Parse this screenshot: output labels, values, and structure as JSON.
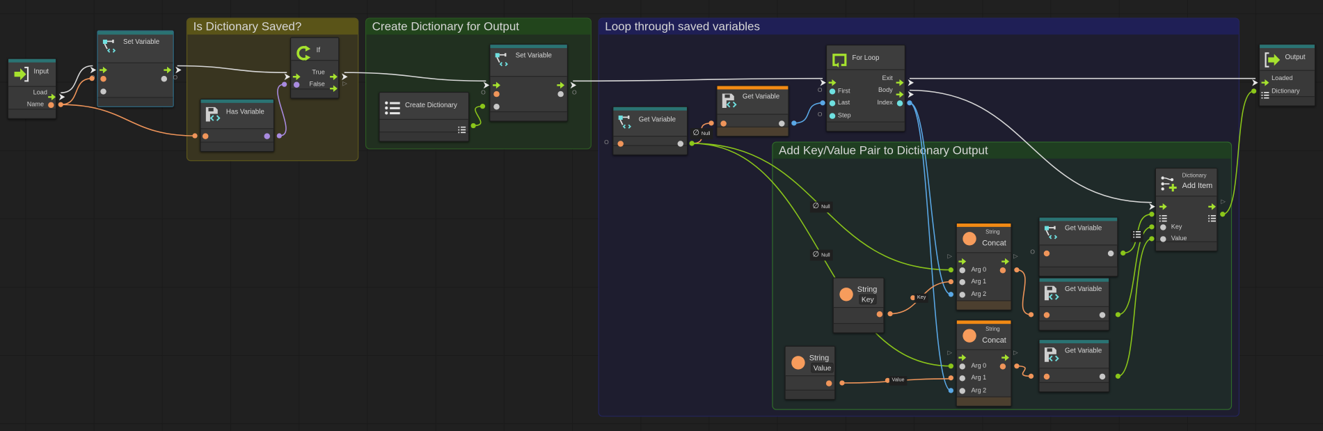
{
  "groups": {
    "is_dictionary_saved": {
      "title": "Is Dictionary Saved?"
    },
    "create_dictionary_for_output": {
      "title": "Create Dictionary for Output"
    },
    "loop_through_saved_variables": {
      "title": "Loop through saved variables"
    },
    "add_key_value_pair": {
      "title": "Add Key/Value Pair to Dictionary Output"
    }
  },
  "nodes": {
    "input": {
      "title": "Input",
      "ports": {
        "load": "Load",
        "name": "Name"
      },
      "icon": "input-enter-icon"
    },
    "set_variable_1": {
      "title": "Set Variable",
      "icon": "set-variable-icon"
    },
    "if": {
      "title": "If",
      "ports": {
        "true": "True",
        "false": "False"
      },
      "icon": "if-branch-icon"
    },
    "has_variable": {
      "title": "Has Variable",
      "icon": "saved-variable-icon"
    },
    "create_dictionary": {
      "title": "Create Dictionary",
      "icon": "list-icon"
    },
    "set_variable_2": {
      "title": "Set Variable",
      "icon": "set-variable-icon"
    },
    "get_variable_object": {
      "title": "Get Variable",
      "icon": "get-variable-icon"
    },
    "get_variable_saved_count": {
      "title": "Get Variable",
      "icon": "saved-variable-icon"
    },
    "for_loop": {
      "title": "For Loop",
      "ports": {
        "first": "First",
        "last": "Last",
        "step": "Step",
        "exit": "Exit",
        "body": "Body",
        "index": "Index"
      },
      "icon": "loop-icon"
    },
    "output": {
      "title": "Output",
      "ports": {
        "loaded": "Loaded",
        "dictionary": "Dictionary"
      },
      "icon": "output-exit-icon"
    },
    "dictionary_add_item": {
      "category": "Dictionary",
      "title": "Add Item",
      "ports": {
        "key": "Key",
        "value": "Value"
      },
      "icon": "dictionary-add-icon"
    },
    "string_concat_1": {
      "category": "String",
      "title": "Concat",
      "ports": {
        "arg0": "Arg 0",
        "arg1": "Arg 1",
        "arg2": "Arg 2"
      },
      "icon": "string-icon"
    },
    "string_concat_2": {
      "category": "String",
      "title": "Concat",
      "ports": {
        "arg0": "Arg 0",
        "arg1": "Arg 1",
        "arg2": "Arg 2"
      },
      "icon": "string-icon"
    },
    "get_variable_key_object": {
      "title": "Get Variable",
      "icon": "get-variable-icon"
    },
    "get_variable_saved_key": {
      "title": "Get Variable",
      "icon": "saved-variable-icon"
    },
    "get_variable_saved_value": {
      "title": "Get Variable",
      "icon": "saved-variable-icon"
    },
    "string_key": {
      "title": "String",
      "value": "Key",
      "icon": "string-icon"
    },
    "string_value": {
      "title": "String",
      "value": "Value",
      "icon": "string-icon"
    }
  },
  "edge_labels": {
    "null": "Null",
    "key": "Key",
    "value": "Value"
  },
  "colors": {
    "flow": "#a6e22e",
    "string": "#f0955a",
    "object": "#c8c8c8",
    "bool": "#a98be0",
    "int": "#6fe0e0",
    "dictionary": "#8bc61a",
    "index_edge": "#5aa8e6",
    "flow_edge": "#d8d8d8",
    "teal_header": "#2a7373",
    "orange_header": "#f28a14"
  }
}
